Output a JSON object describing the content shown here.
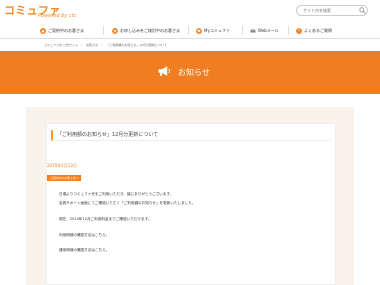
{
  "brand": {
    "logo_main": "コミュファ",
    "logo_sub": "Powered by ctc",
    "primary_color": "#ef7e22",
    "accent_color": "#f0a020"
  },
  "search": {
    "placeholder": "サイト内を検索"
  },
  "nav": {
    "items": [
      {
        "label": "ご契約中のお客さま",
        "icon": "house-icon",
        "color": "#ef7e22"
      },
      {
        "label": "お申し込みをご検討中のお客さま",
        "icon": "cart-icon",
        "color": "#ef7e22"
      },
      {
        "label": "Myコミュファ",
        "icon": "heart-icon",
        "color": "#ef7e22"
      },
      {
        "label": "Webメール",
        "icon": "mail-icon",
        "color": "#666666"
      },
      {
        "label": "よくあるご質問",
        "icon": "question-icon",
        "color": "#ef7e22"
      }
    ]
  },
  "breadcrumb": [
    "コミュファ光 公式サイト",
    "お知らせ",
    "「ご利用額のお知らせ」12月分更新について"
  ],
  "hero": {
    "title": "お知らせ",
    "icon": "megaphone-icon"
  },
  "article": {
    "title": "「ご利用額のお知らせ」12月分更新について",
    "date": "2015年1月13日",
    "tag": "ご契約中のお客さまへ",
    "paragraphs": [
      "日頃よりコミュファ光をご利用いただき、誠にありがとうございます。",
      "会員サポート画面にてご確認いただく「ご利用額のお知らせ」を更新いたしました。",
      "現在、2014年12月ご利用料金までご確認いただけます。",
      "利用明細の確認方法はこちら。",
      "通信明細の確認方法はこちら。"
    ]
  }
}
